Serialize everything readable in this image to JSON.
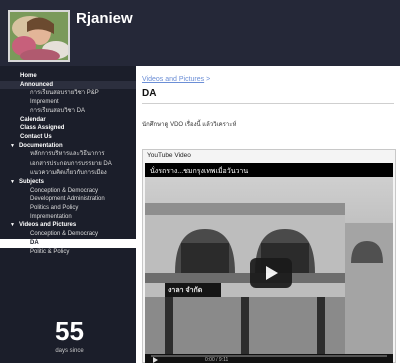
{
  "site": {
    "title": "Rjaniew"
  },
  "sidebar": {
    "items": [
      {
        "label": "Home",
        "kind": "top"
      },
      {
        "label": "Announced",
        "kind": "top"
      },
      {
        "label": "การเรียนสอบรายวิชา P&P",
        "kind": "sub"
      },
      {
        "label": "Imprement",
        "kind": "sub"
      },
      {
        "label": "การเรียนสอบวิชา DA",
        "kind": "sub"
      },
      {
        "label": "Calendar",
        "kind": "top"
      },
      {
        "label": "Class Assigned",
        "kind": "top"
      },
      {
        "label": "Contact Us",
        "kind": "top"
      },
      {
        "label": "Documentation",
        "kind": "section"
      },
      {
        "label": "หลักการบริหารและวิธีนาการ",
        "kind": "sub"
      },
      {
        "label": "เอกสารประกอบการบรรยาย DA",
        "kind": "sub"
      },
      {
        "label": "แนวความคิดเกี่ยวกับการเมือง",
        "kind": "sub"
      },
      {
        "label": "Subjects",
        "kind": "section"
      },
      {
        "label": "Conception & Democracy",
        "kind": "sub"
      },
      {
        "label": "Development Administration",
        "kind": "sub"
      },
      {
        "label": "Politics and Policy",
        "kind": "sub"
      },
      {
        "label": "Imprementation",
        "kind": "sub"
      },
      {
        "label": "Videos and Pictures",
        "kind": "section"
      },
      {
        "label": "Conception & Democracy",
        "kind": "sub"
      },
      {
        "label": "DA",
        "kind": "selected"
      },
      {
        "label": "Politic & Policy",
        "kind": "sub"
      }
    ]
  },
  "counter": {
    "value": "55",
    "label": "days since"
  },
  "main": {
    "breadcrumb_link": "Videos and Pictures",
    "breadcrumb_sep": " >",
    "title": "DA",
    "description": "นักศึกษาดู VDO เรื่องนี้ แล้ววิเคราะห์",
    "youtube_label": "YouTube Video",
    "video_title": "นั่งรถราง...ชมกรุงเทพเมื่อวันวาน",
    "video_time": "0:00 / 9:11",
    "sign_text": "งาลา จำกัด"
  },
  "colors": {
    "header_bg": "#252838",
    "sidebar_bg": "#1b1e2a",
    "link": "#6b8ed6"
  }
}
